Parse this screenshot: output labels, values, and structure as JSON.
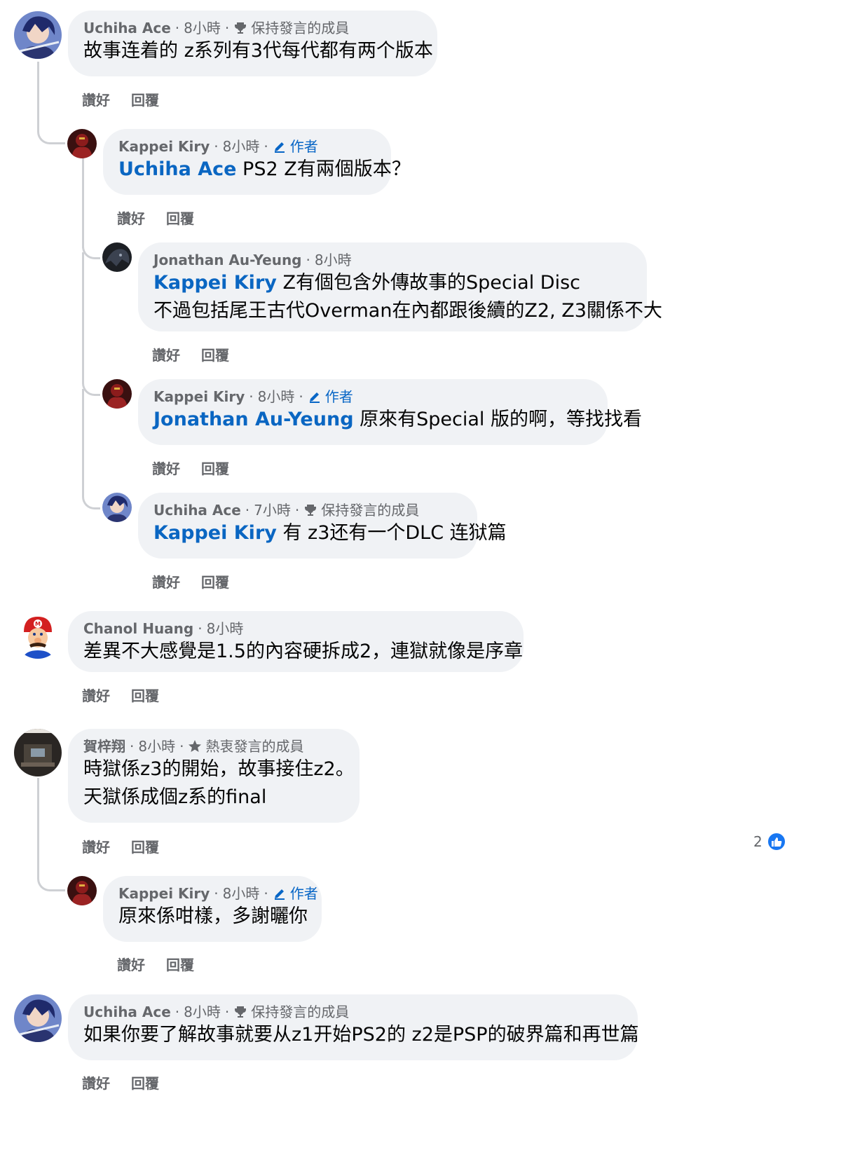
{
  "labels": {
    "like": "讚好",
    "reply": "回覆",
    "author": "作者",
    "top_fan": "保持發言的成員",
    "rising_fan": "熱衷發言的成員"
  },
  "comments": [
    {
      "name": "Uchiha Ace",
      "time": "8小時",
      "badge": "保持發言的成員",
      "text": "故事连着的 z系列有3代每代都有两个版本"
    },
    {
      "name": "Kappei Kiry",
      "time": "8小時",
      "badge": "作者",
      "mention": "Uchiha Ace",
      "text": " PS2 Z有兩個版本？"
    },
    {
      "name": "Jonathan Au-Yeung",
      "time": "8小時",
      "mention": "Kappei Kiry",
      "text": " Z有個包含外傳故事的Special Disc",
      "text2": "不過包括尾王古代Overman在內都跟後續的Z2, Z3關係不大"
    },
    {
      "name": "Kappei Kiry",
      "time": "8小時",
      "badge": "作者",
      "mention": "Jonathan Au-Yeung",
      "text": " 原來有Special 版的啊，等找找看"
    },
    {
      "name": "Uchiha Ace",
      "time": "7小時",
      "badge": "保持發言的成員",
      "mention": "Kappei Kiry",
      "text": " 有 z3还有一个DLC 连狱篇"
    },
    {
      "name": "Chanol Huang",
      "time": "8小時",
      "text": "差異不大感覺是1.5的內容硬拆成2，連獄就像是序章"
    },
    {
      "name": "賀梓翔",
      "time": "8小時",
      "badge": "熱衷發言的成員",
      "text": "時獄係z3的開始，故事接住z2。",
      "text2": "天獄係成個z系的final",
      "reactions": "2"
    },
    {
      "name": "Kappei Kiry",
      "time": "8小時",
      "badge": "作者",
      "text": "原來係咁樣，多謝曬你"
    },
    {
      "name": "Uchiha Ace",
      "time": "8小時",
      "badge": "保持發言的成員",
      "text": "如果你要了解故事就要从z1开始PS2的 z2是PSP的破界篇和再世篇"
    }
  ]
}
